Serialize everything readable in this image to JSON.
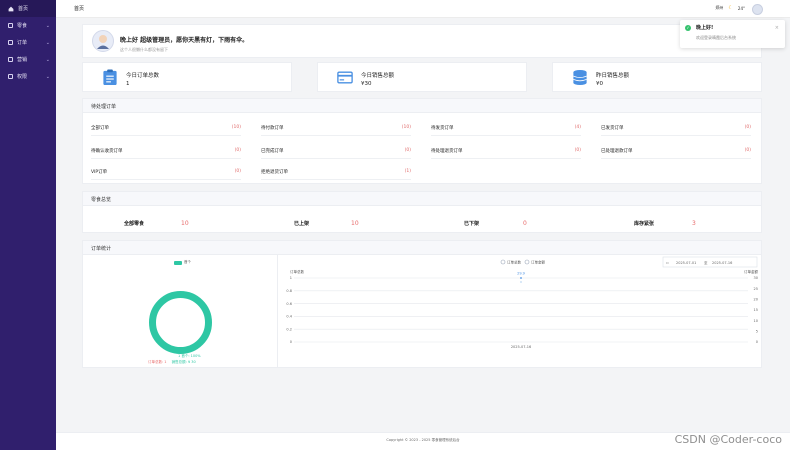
{
  "sidebar": {
    "items": [
      {
        "label": "首页",
        "has_chevron": false
      },
      {
        "label": "零食",
        "has_chevron": true
      },
      {
        "label": "订单",
        "has_chevron": true
      },
      {
        "label": "营销",
        "has_chevron": true
      },
      {
        "label": "权限",
        "has_chevron": true
      }
    ]
  },
  "topbar": {
    "breadcrumb": "首页",
    "city": "郑州",
    "temperature": "24°",
    "weather_icon": "moon-icon"
  },
  "toast": {
    "title": "晚上好!",
    "message": "欢迎登录晴霞后台系统",
    "status_color": "#35c26e"
  },
  "welcome": {
    "greeting": "晚上好 超级管理员，愿你天黑有灯，下雨有伞。",
    "subtitle": "这个人很懒什么都没有留下"
  },
  "stats": [
    {
      "label": "今日订单总数",
      "value": "1",
      "icon": "clipboard-icon"
    },
    {
      "label": "今日销售总额",
      "value": "¥30",
      "icon": "credit-card-icon"
    },
    {
      "label": "昨日销售总额",
      "value": "¥0",
      "icon": "database-icon"
    }
  ],
  "pending": {
    "title": "待处理订单",
    "items": [
      {
        "label": "全部订单",
        "value": "(10)"
      },
      {
        "label": "待付款订单",
        "value": "(10)"
      },
      {
        "label": "待发货订单",
        "value": "(4)"
      },
      {
        "label": "已发货订单",
        "value": "(0)"
      },
      {
        "label": "待确认收货订单",
        "value": "(0)"
      },
      {
        "label": "已完成订单",
        "value": "(0)"
      },
      {
        "label": "待处理退货订单",
        "value": "(0)"
      },
      {
        "label": "已处理退款订单",
        "value": "(0)"
      },
      {
        "label": "VIP订单",
        "value": "(0)"
      },
      {
        "label": "拒绝退货订单",
        "value": "(1)"
      }
    ]
  },
  "goods": {
    "title": "零食总览",
    "items": [
      {
        "label": "全部零食",
        "value": "10"
      },
      {
        "label": "已上架",
        "value": "10"
      },
      {
        "label": "已下架",
        "value": "0"
      },
      {
        "label": "库存紧张",
        "value": "3"
      }
    ]
  },
  "order_stats": {
    "title": "订单统计",
    "donut_legend": "首个",
    "donut_pct_label": "1 首个: 100%",
    "donut_bottom_left": "订单总数: 1",
    "donut_bottom_right": "销售总额: ¥ 30",
    "line_legend_a": "订单总数",
    "line_legend_b": "订单金额",
    "date_start": "2025-07-01",
    "date_sep": "至",
    "date_end": "2025-07-16",
    "calendar_icon": "calendar-icon"
  },
  "chart_data": [
    {
      "type": "pie",
      "categories": [
        "首个"
      ],
      "values": [
        1
      ],
      "colors": [
        "#2ec7a4"
      ]
    },
    {
      "type": "line",
      "xlabel": "",
      "ylabel": "订单总数",
      "y2label": "订单金额",
      "categories": [
        "2025-07-16"
      ],
      "series": [
        {
          "name": "订单总数",
          "values": [
            1
          ]
        },
        {
          "name": "订单金额",
          "values": [
            30
          ]
        }
      ],
      "point_label": "29.9",
      "ylim": [
        0,
        1
      ],
      "yticks": [
        "1",
        "0.8",
        "0.6",
        "0.4",
        "0.2",
        "0"
      ],
      "y2lim": [
        0,
        30
      ],
      "y2ticks": [
        "30",
        "25",
        "20",
        "15",
        "10",
        "5",
        "0"
      ],
      "grid": true
    }
  ],
  "footer": {
    "copyright": "Copyright © 2023 - 2025  零食管理系统后台"
  },
  "watermark": "CSDN @Coder-coco"
}
